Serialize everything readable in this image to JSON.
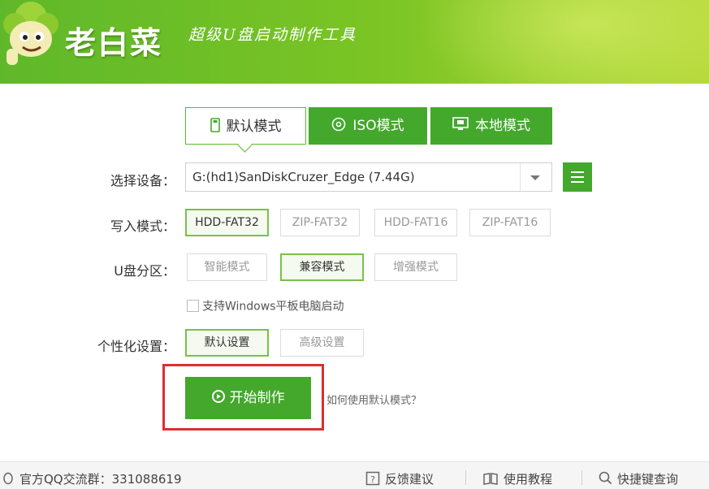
{
  "header": {
    "brand_name": "老白菜",
    "slogan": "超级U盘启动制作工具"
  },
  "tabs": [
    {
      "label": "默认模式",
      "active": true,
      "icon": "usb-icon"
    },
    {
      "label": "ISO模式",
      "active": false,
      "icon": "disc-icon"
    },
    {
      "label": "本地模式",
      "active": false,
      "icon": "monitor-icon"
    }
  ],
  "device": {
    "label": "选择设备：",
    "value": "G:(hd1)SanDiskCruzer_Edge (7.44G)"
  },
  "write_mode": {
    "label": "写入模式：",
    "options": [
      "HDD-FAT32",
      "ZIP-FAT32",
      "HDD-FAT16",
      "ZIP-FAT16"
    ],
    "selected": "HDD-FAT32"
  },
  "partition": {
    "label": "U盘分区：",
    "options": [
      "智能模式",
      "兼容模式",
      "增强模式"
    ],
    "selected": "兼容模式"
  },
  "tablet_boot": {
    "label": "支持Windows平板电脑启动",
    "checked": false
  },
  "personalize": {
    "label": "个性化设置：",
    "options": [
      "默认设置",
      "高级设置"
    ],
    "selected": "默认设置"
  },
  "start_button": "开始制作",
  "help_link": "如何使用默认模式？",
  "footer": {
    "qq_group": "官方QQ交流群：331088619",
    "feedback": "反馈建议",
    "tutorial": "使用教程",
    "shortcut": "快捷键查询"
  },
  "colors": {
    "brand_green": "#43a82c",
    "highlight_red": "#d93030"
  }
}
